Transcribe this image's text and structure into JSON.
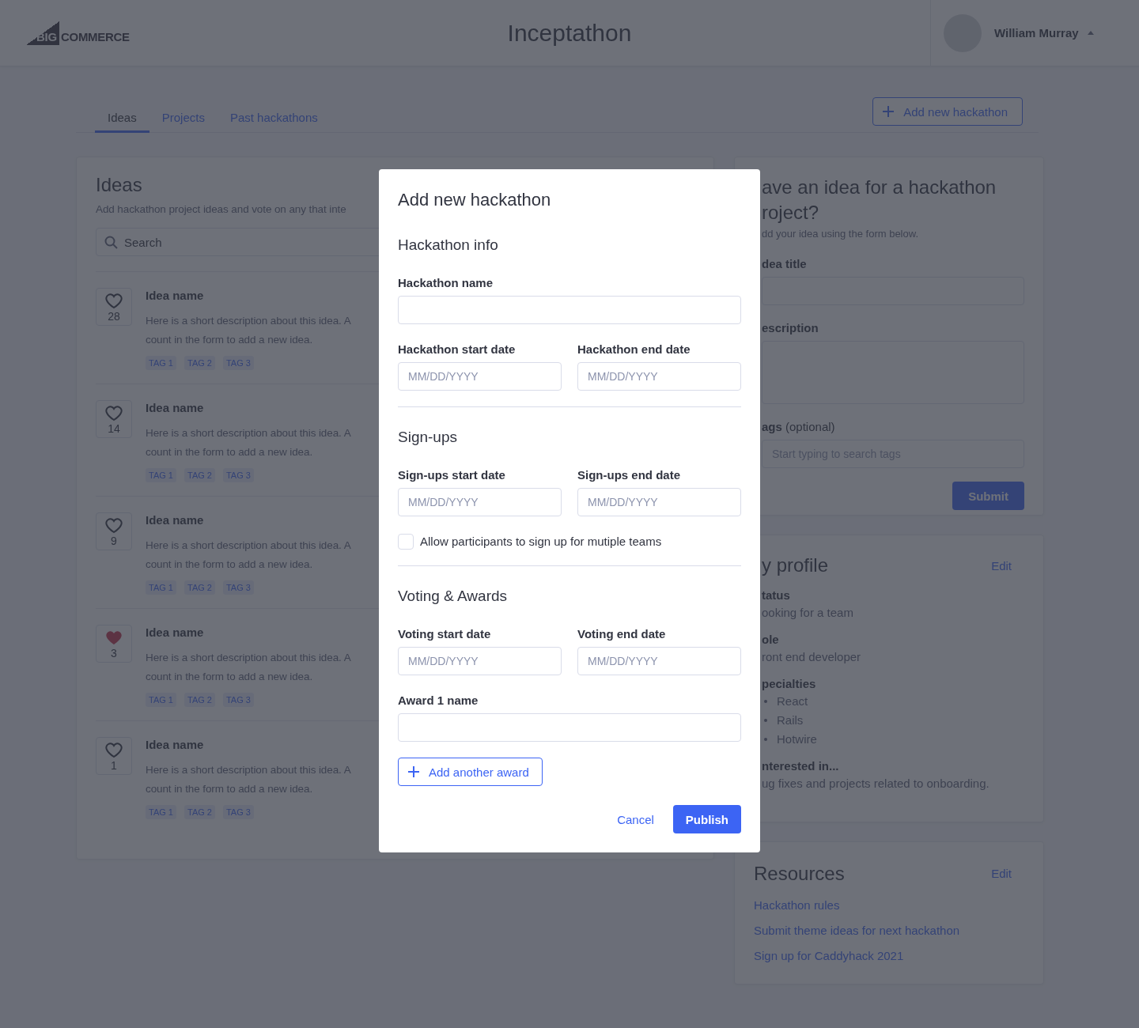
{
  "header": {
    "logo": {
      "mark": "BIG",
      "word": "COMMERCE"
    },
    "title": "Inceptathon",
    "user": {
      "name": "William Murray"
    }
  },
  "tabs": [
    {
      "label": "Ideas",
      "selected": true
    },
    {
      "label": "Projects",
      "selected": false
    },
    {
      "label": "Past hackathons",
      "selected": false
    }
  ],
  "add_hackathon_button": "Add new hackathon",
  "ideas": {
    "title": "Ideas",
    "subtitle": "Add hackathon project ideas and vote on any that inte",
    "search": {
      "placeholder": "Search"
    },
    "items": [
      {
        "votes": "28",
        "liked": false,
        "name": "Idea name",
        "description_lines": [
          "Here is a short description about this idea. A",
          "count in the form to add a new idea."
        ],
        "tags": [
          "TAG 1",
          "TAG 2",
          "TAG 3"
        ]
      },
      {
        "votes": "14",
        "liked": false,
        "name": "Idea name",
        "description_lines": [
          "Here is a short description about this idea. A",
          "count in the form to add a new idea."
        ],
        "tags": [
          "TAG 1",
          "TAG 2",
          "TAG 3"
        ]
      },
      {
        "votes": "9",
        "liked": false,
        "name": "Idea name",
        "description_lines": [
          "Here is a short description about this idea. A",
          "count in the form to add a new idea."
        ],
        "tags": [
          "TAG 1",
          "TAG 2",
          "TAG 3"
        ]
      },
      {
        "votes": "3",
        "liked": true,
        "name": "Idea name",
        "description_lines": [
          "Here is a short description about this idea. A",
          "count in the form to add a new idea."
        ],
        "tags": [
          "TAG 1",
          "TAG 2",
          "TAG 3"
        ]
      },
      {
        "votes": "1",
        "liked": false,
        "name": "Idea name",
        "description_lines": [
          "Here is a short description about this idea. A",
          "count in the form to add a new idea."
        ],
        "tags": [
          "TAG 1",
          "TAG 2",
          "TAG 3"
        ]
      }
    ]
  },
  "idea_form": {
    "title_lines": [
      "ave an idea for a hackathon",
      "roject?"
    ],
    "subtitle": "dd your idea using the form below.",
    "fields": [
      {
        "kind": "input",
        "label": "dea title"
      },
      {
        "kind": "textarea",
        "label": "escription"
      },
      {
        "kind": "input",
        "label": "**ags** (optional)",
        "placeholder": "Start typing to search tags"
      }
    ],
    "submit": "Submit"
  },
  "profile": {
    "title": "y profile",
    "edit": "Edit",
    "sections": [
      {
        "kind": "text",
        "label": "tatus",
        "value": "ooking for a team"
      },
      {
        "kind": "text",
        "label": "ole",
        "value": "ront end developer"
      },
      {
        "kind": "list",
        "label": "pecialties",
        "items": [
          "React",
          "Rails",
          "Hotwire"
        ]
      },
      {
        "kind": "text",
        "label": "nterested in...",
        "value": "ug fixes and projects related to onboarding."
      }
    ]
  },
  "resources": {
    "title": "Resources",
    "edit": "Edit",
    "links": [
      "Hackathon rules",
      "Submit theme ideas for next hackathon",
      "Sign up for Caddyhack 2021"
    ]
  },
  "modal": {
    "title": "Add new hackathon",
    "sections": [
      {
        "title": "Hackathon info",
        "rows": [
          [
            {
              "label": "Hackathon name"
            }
          ],
          [
            {
              "label": "Hackathon start date",
              "placeholder": "MM/DD/YYYY"
            },
            {
              "label": "Hackathon end date",
              "placeholder": "MM/DD/YYYY"
            }
          ]
        ]
      },
      {
        "title": "Sign-ups",
        "rows": [
          [
            {
              "label": "Sign-ups start date",
              "placeholder": "MM/DD/YYYY"
            },
            {
              "label": "Sign-ups end date",
              "placeholder": "MM/DD/YYYY"
            }
          ]
        ],
        "checkbox": {
          "label": "Allow participants to sign up for mutiple teams",
          "checked": false
        }
      },
      {
        "title": "Voting & Awards",
        "rows": [
          [
            {
              "label": "Voting start date",
              "placeholder": "MM/DD/YYYY"
            },
            {
              "label": "Voting end date",
              "placeholder": "MM/DD/YYYY"
            }
          ],
          [
            {
              "label": "Award 1 name"
            }
          ]
        ],
        "add_button": "Add another award"
      }
    ],
    "cancel": "Cancel",
    "publish": "Publish"
  }
}
